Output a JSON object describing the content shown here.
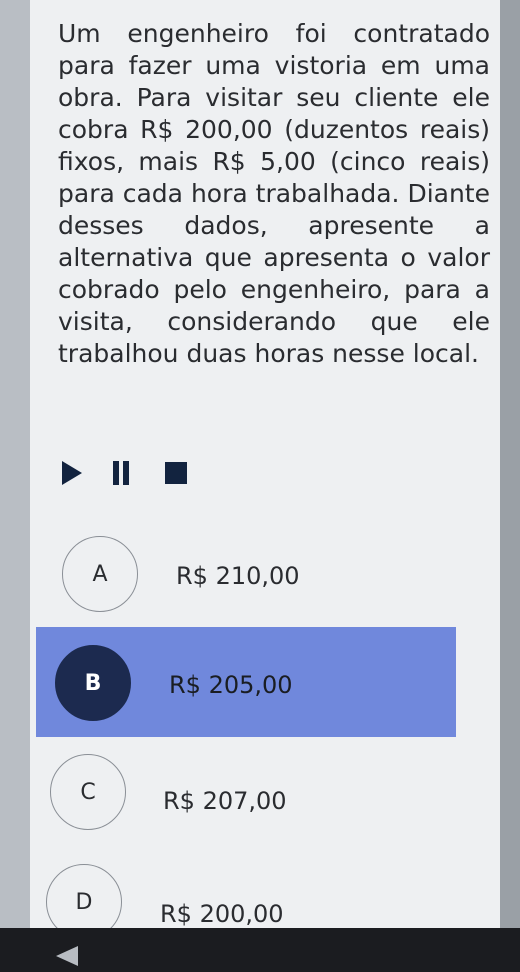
{
  "question": {
    "text": "Um engenheiro foi contratado para fazer uma vistoria em uma obra. Para visitar seu cliente ele cobra R$ 200,00 (duzentos reais) fixos, mais R$ 5,00 (cinco reais) para cada hora trabalhada. Diante desses dados, apresente a alternativa que apresenta o valor cobrado pelo engenheiro, para a visita, considerando que ele trabalhou duas horas nesse local."
  },
  "player": {
    "icons": [
      "play-icon",
      "pause-icon",
      "stop-icon"
    ]
  },
  "options": [
    {
      "letter": "A",
      "text": "R$ 210,00",
      "selected": false
    },
    {
      "letter": "B",
      "text": "R$ 205,00",
      "selected": true
    },
    {
      "letter": "C",
      "text": "R$ 207,00",
      "selected": false
    },
    {
      "letter": "D",
      "text": "R$ 200,00",
      "selected": false
    }
  ],
  "colors": {
    "selected_background": "#7088dc",
    "selected_badge": "#1c2a4f",
    "icon": "#12233f"
  }
}
